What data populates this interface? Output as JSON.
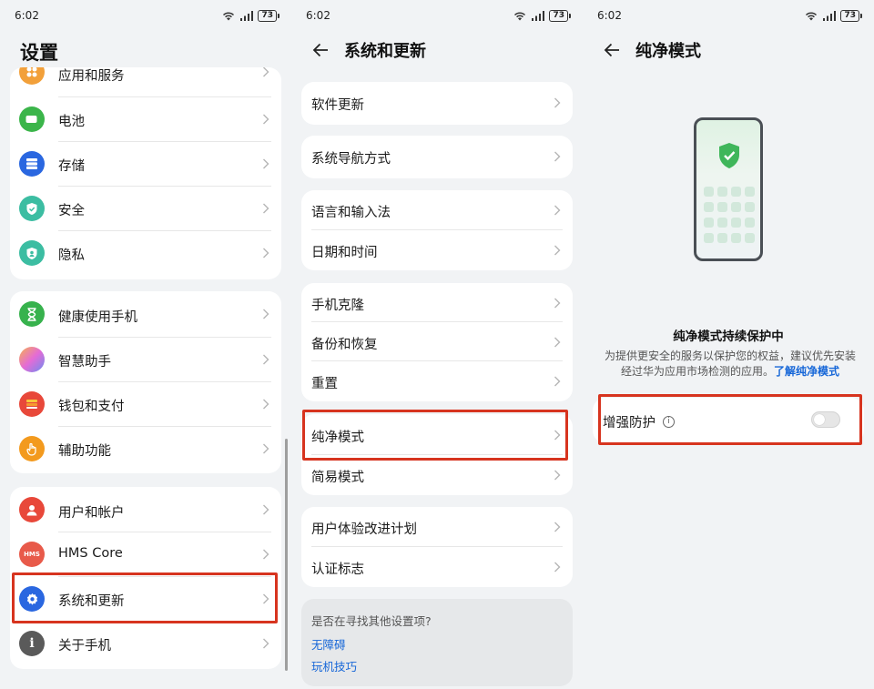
{
  "status_bar": {
    "time": "6:02",
    "battery": "73"
  },
  "panel1": {
    "title": "设置",
    "group1": [
      {
        "label": "应用和服务",
        "icon": "apps-icon",
        "color": "#f2a03a"
      },
      {
        "label": "电池",
        "icon": "battery-icon",
        "color": "#3bb54a"
      },
      {
        "label": "存储",
        "icon": "storage-icon",
        "color": "#2a67e0"
      },
      {
        "label": "安全",
        "icon": "security-shield-icon",
        "color": "#3cbda2"
      },
      {
        "label": "隐私",
        "icon": "privacy-shield-icon",
        "color": "#3cbda2"
      }
    ],
    "group2": [
      {
        "label": "健康使用手机",
        "icon": "hourglass-icon",
        "color": "#37b24d"
      },
      {
        "label": "智慧助手",
        "icon": "assistant-orb-icon",
        "color": "#e46bd6"
      },
      {
        "label": "钱包和支付",
        "icon": "wallet-icon",
        "color": "#e8483a"
      },
      {
        "label": "辅助功能",
        "icon": "hand-icon",
        "color": "#f39a1e"
      }
    ],
    "group3": [
      {
        "label": "用户和帐户",
        "icon": "user-icon",
        "color": "#e8483a"
      },
      {
        "label": "HMS Core",
        "icon": "hms-icon",
        "color": "#e85a4a",
        "icon_text": "HMS"
      },
      {
        "label": "系统和更新",
        "icon": "gear-icon",
        "color": "#2a67e0"
      },
      {
        "label": "关于手机",
        "icon": "info-icon",
        "color": "#5a5a5a"
      }
    ]
  },
  "panel2": {
    "title": "系统和更新",
    "cards": [
      [
        "软件更新"
      ],
      [
        "系统导航方式"
      ],
      [
        "语言和输入法",
        "日期和时间"
      ],
      [
        "手机克隆",
        "备份和恢复",
        "重置"
      ],
      [
        "纯净模式",
        "简易模式"
      ],
      [
        "用户体验改进计划",
        "认证标志"
      ]
    ],
    "tips": {
      "question": "是否在寻找其他设置项?",
      "links": [
        "无障碍",
        "玩机技巧"
      ]
    }
  },
  "panel3": {
    "title": "纯净模式",
    "status_heading": "纯净模式持续保护中",
    "description": "为提供更安全的服务以保护您的权益，建议优先安装经过华为应用市场检测的应用。",
    "learn_more": "了解纯净模式",
    "enhanced_protection": {
      "label": "增强防护",
      "enabled": false
    }
  },
  "colors": {
    "highlight": "#d7341f",
    "link": "#1767d8",
    "card": "#ffffff",
    "background": "#f1f3f5"
  }
}
